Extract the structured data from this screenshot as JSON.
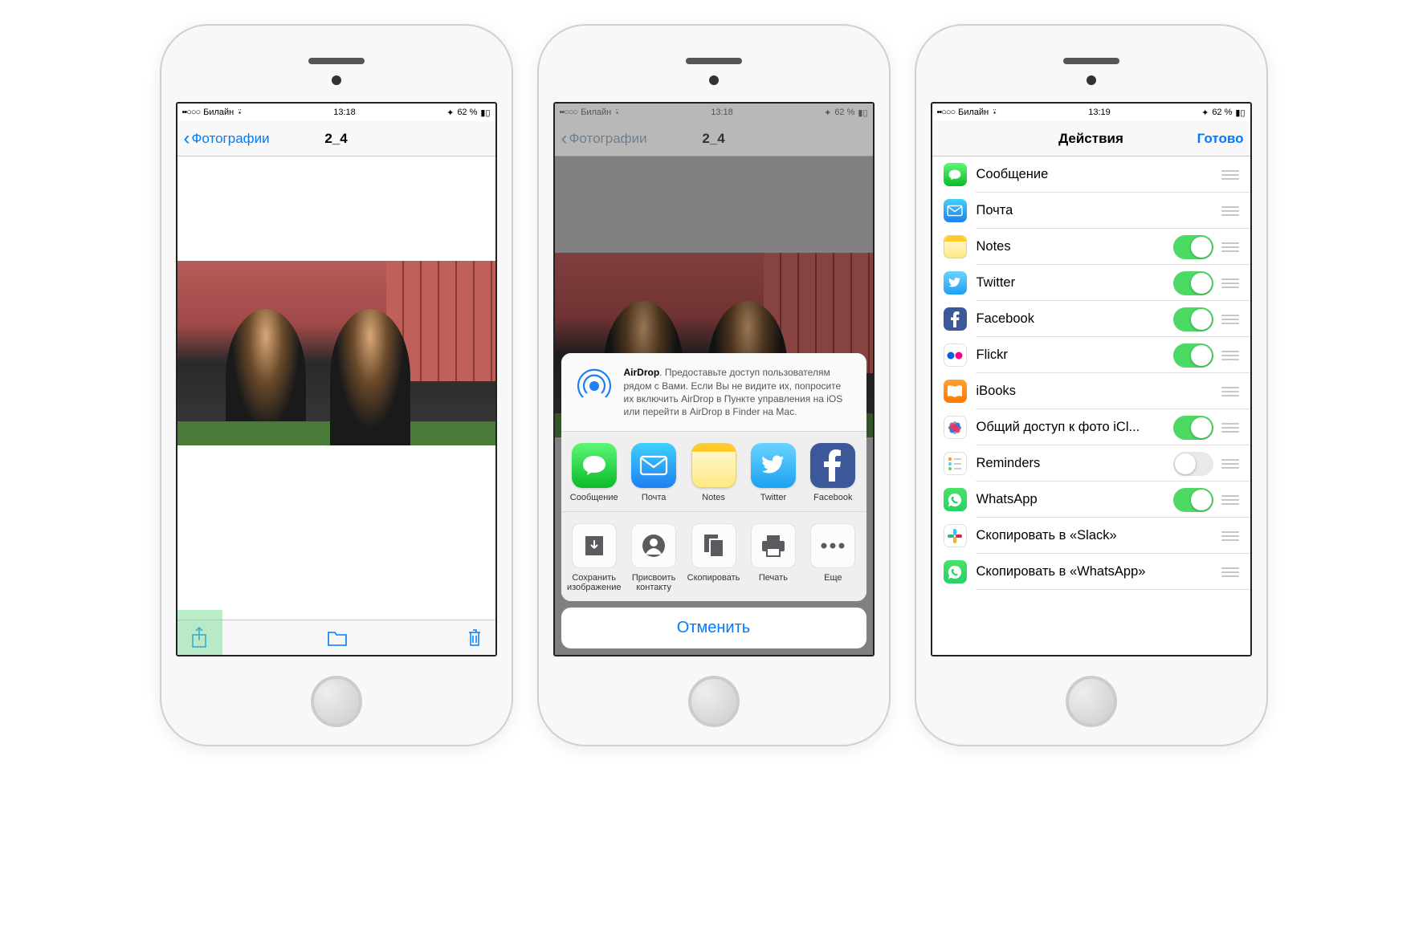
{
  "status": {
    "carrier": "Билайн",
    "battery": "62 %"
  },
  "phone1": {
    "time": "13:18",
    "back": "Фотографии",
    "title": "2_4"
  },
  "phone2": {
    "time": "13:18",
    "back": "Фотографии",
    "title": "2_4",
    "airdrop_bold": "AirDrop",
    "airdrop_text": ". Предоставьте доступ пользователям рядом с Вами. Если Вы не видите их, попросите их включить AirDrop в Пункте управления на iOS или перейти в AirDrop в Finder на Mac.",
    "apps": [
      {
        "label": "Сообщение"
      },
      {
        "label": "Почта"
      },
      {
        "label": "Notes"
      },
      {
        "label": "Twitter"
      },
      {
        "label": "Facebook"
      }
    ],
    "actions": [
      {
        "label": "Сохранить изображение"
      },
      {
        "label": "Присвоить контакту"
      },
      {
        "label": "Скопировать"
      },
      {
        "label": "Печать"
      },
      {
        "label": "Еще"
      }
    ],
    "cancel": "Отменить"
  },
  "phone3": {
    "time": "13:19",
    "title": "Действия",
    "done": "Готово",
    "rows": [
      {
        "label": "Сообщение",
        "switch": null
      },
      {
        "label": "Почта",
        "switch": null
      },
      {
        "label": "Notes",
        "switch": true
      },
      {
        "label": "Twitter",
        "switch": true
      },
      {
        "label": "Facebook",
        "switch": true
      },
      {
        "label": "Flickr",
        "switch": true
      },
      {
        "label": "iBooks",
        "switch": null
      },
      {
        "label": "Общий доступ к фото iCl...",
        "switch": true
      },
      {
        "label": "Reminders",
        "switch": false
      },
      {
        "label": "WhatsApp",
        "switch": true
      },
      {
        "label": "Скопировать в «Slack»",
        "switch": null
      },
      {
        "label": "Скопировать в «WhatsApp»",
        "switch": null
      }
    ]
  }
}
